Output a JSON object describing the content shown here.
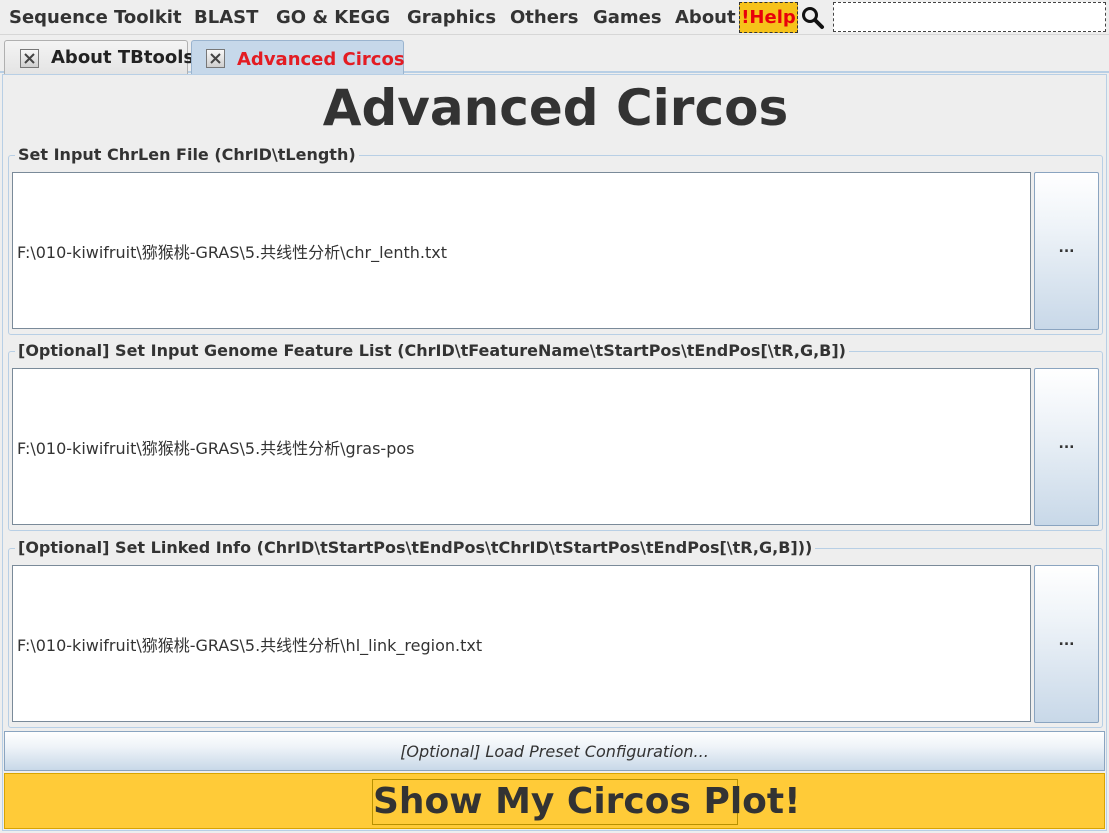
{
  "menu": {
    "items": [
      "Sequence Toolkit",
      "BLAST",
      "GO & KEGG",
      "Graphics",
      "Others",
      "Games",
      "About"
    ],
    "help_label": "!Help",
    "search_value": ""
  },
  "tabs": [
    {
      "label": "About TBtools",
      "active": false
    },
    {
      "label": "Advanced Circos",
      "active": true
    }
  ],
  "page": {
    "title": "Advanced Circos"
  },
  "sections": [
    {
      "legend": "Set Input ChrLen File (ChrID\\tLength)",
      "path": "F:\\010-kiwifruit\\猕猴桃-GRAS\\5.共线性分析\\chr_lenth.txt",
      "browse_label": "..."
    },
    {
      "legend": "[Optional] Set Input Genome Feature List (ChrID\\tFeatureName\\tStartPos\\tEndPos[\\tR,G,B])",
      "path": "F:\\010-kiwifruit\\猕猴桃-GRAS\\5.共线性分析\\gras-pos",
      "browse_label": "..."
    },
    {
      "legend": "[Optional] Set Linked Info (ChrID\\tStartPos\\tEndPos\\tChrID\\tStartPos\\tEndPos[\\tR,G,B]))",
      "path": "F:\\010-kiwifruit\\猕猴桃-GRAS\\5.共线性分析\\hl_link_region.txt",
      "browse_label": "..."
    }
  ],
  "preset_label": "[Optional] Load Preset Configuration...",
  "show_label": "Show My Circos Plot!",
  "colors": {
    "accent_yellow": "#ffcb38",
    "help_bg": "#f6c21a",
    "active_tab_text": "#e31c23",
    "border_blue": "#b8cfe5"
  }
}
